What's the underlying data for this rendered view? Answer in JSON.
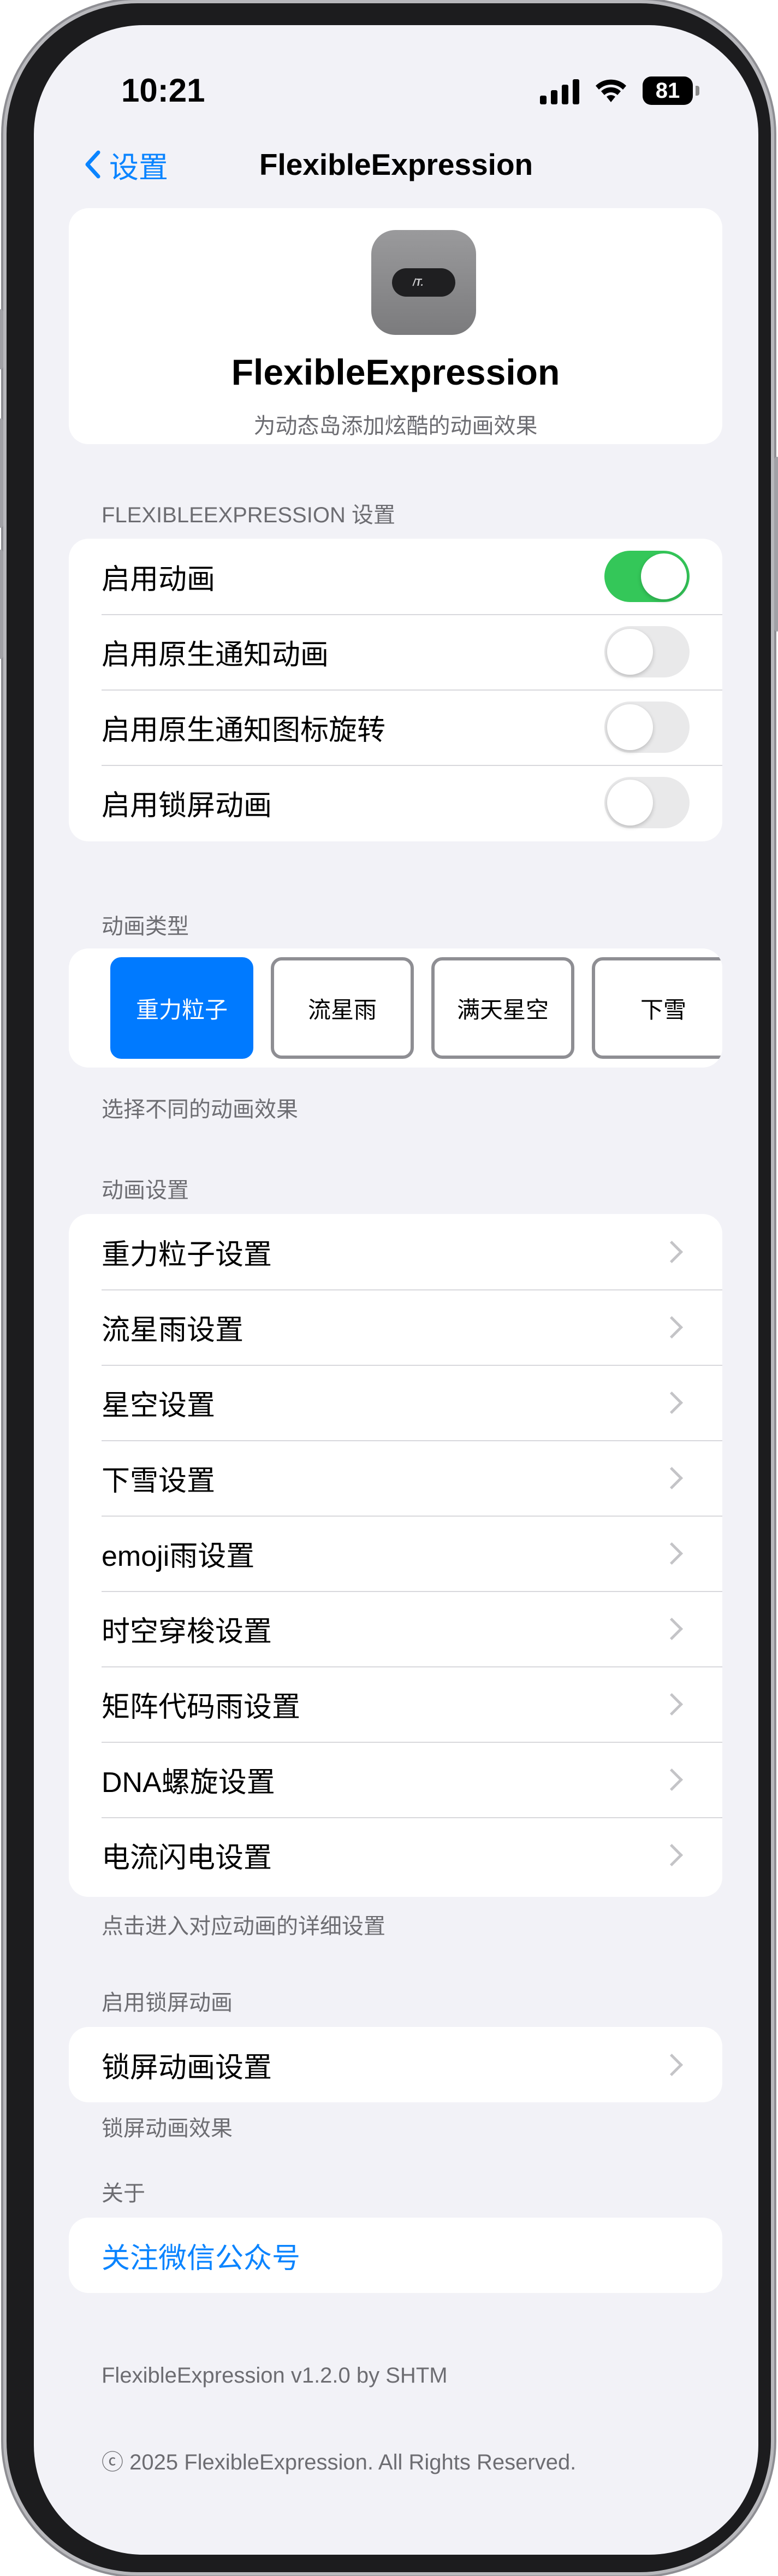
{
  "status_bar": {
    "time": "10:21",
    "battery": "81"
  },
  "nav": {
    "back_label": "设置",
    "title": "FlexibleExpression"
  },
  "app": {
    "icon_text": "/T.",
    "name": "FlexibleExpression",
    "subtitle": "为动态岛添加炫酷的动画效果"
  },
  "settings_section": {
    "header": "FLEXIBLEEXPRESSION 设置",
    "rows": [
      {
        "label": "启用动画",
        "toggle": true
      },
      {
        "label": "启用原生通知动画",
        "toggle": false
      },
      {
        "label": "启用原生通知图标旋转",
        "toggle": false
      },
      {
        "label": "启用锁屏动画",
        "toggle": false
      }
    ]
  },
  "type_section": {
    "header": "动画类型",
    "options": [
      "重力粒子",
      "流星雨",
      "满天星空",
      "下雪"
    ],
    "selected": "重力粒子",
    "footer": "选择不同的动画效果"
  },
  "anim_settings_section": {
    "header": "动画设置",
    "rows": [
      "重力粒子设置",
      "流星雨设置",
      "星空设置",
      "下雪设置",
      "emoji雨设置",
      "时空穿梭设置",
      "矩阵代码雨设置",
      "DNA螺旋设置",
      "电流闪电设置"
    ],
    "footer": "点击进入对应动画的详细设置"
  },
  "lockscreen_section": {
    "header": "启用锁屏动画",
    "row": "锁屏动画设置",
    "footer": "锁屏动画效果"
  },
  "about_section": {
    "header": "关于",
    "link": "关注微信公众号"
  },
  "footer": {
    "version": "FlexibleExpression v1.2.0 by SHTM",
    "copyright": "ⓒ 2025 FlexibleExpression. All Rights Reserved."
  },
  "colors": {
    "accent": "#007aff",
    "toggle_on": "#34c759",
    "background": "#f2f2f7"
  }
}
